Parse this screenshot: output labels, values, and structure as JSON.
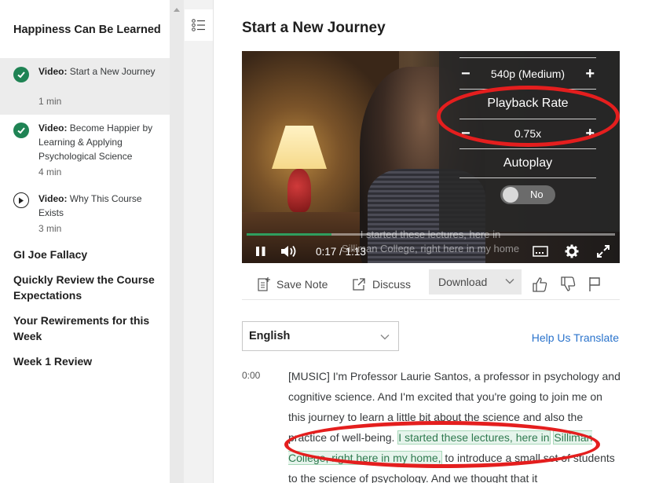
{
  "sidebar": {
    "module_title": "Happiness Can Be Learned",
    "lessons": [
      {
        "type": "Video:",
        "title": "Start a New Journey",
        "duration": "1 min",
        "status": "completed",
        "active": true
      },
      {
        "type": "Video:",
        "title": "Become Happier by Learning & Applying Psychological Science",
        "duration": "4 min",
        "status": "completed",
        "active": false
      },
      {
        "type": "Video:",
        "title": "Why This Course Exists",
        "duration": "3 min",
        "status": "not-started",
        "active": false
      }
    ],
    "nav_items": [
      "GI Joe Fallacy",
      "Quickly Review the Course Expectations",
      "Your Rewirements for this Week",
      "Week 1 Review"
    ]
  },
  "main": {
    "page_title": "Start a New Journey",
    "player": {
      "quality": "540p (Medium)",
      "playback_rate_label": "Playback Rate",
      "playback_rate": "0.75x",
      "autoplay_label": "Autoplay",
      "autoplay_state": "No",
      "current_time": "0:17",
      "time_separator": "/",
      "duration": "1:13",
      "progress_fraction": 0.23,
      "caption_line1": "I started these lectures, here in",
      "caption_line2": "Silliman College, right here in my home"
    },
    "toolbar": {
      "save_note": "Save Note",
      "discuss": "Discuss",
      "download": "Download"
    },
    "transcript": {
      "language": "English",
      "help_link": "Help Us Translate",
      "timestamp": "0:00",
      "text_before": "[MUSIC] I'm Professor Laurie Santos, a professor in psychology and cognitive science. And I'm excited that you're going to join me on this journey to learn a little bit about the science and also the practice of well-being. ",
      "text_highlight_1": "I started these lectures, here in",
      "text_highlight_2": "Silliman College, right here in my home,",
      "text_after": " to introduce a small set of students to the science of psychology. And we thought that it"
    }
  },
  "colors": {
    "accent_green": "#1f8354",
    "link_blue": "#2a73cc",
    "annotation_red": "#e41e1e"
  }
}
